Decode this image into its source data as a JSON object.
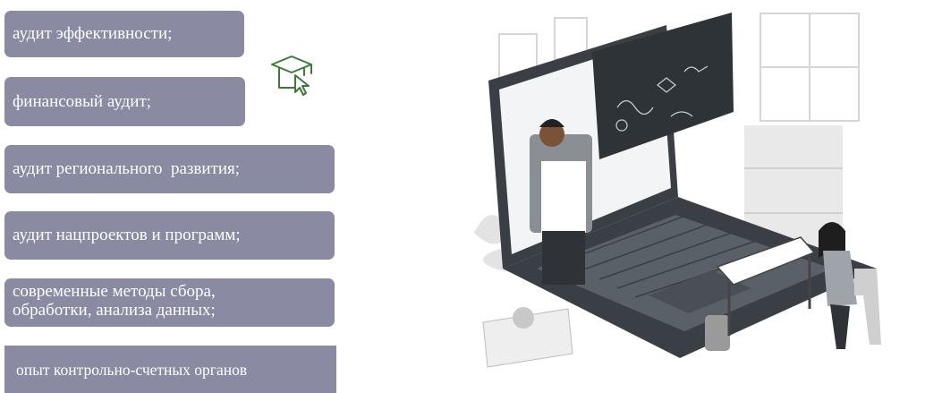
{
  "topics": [
    "аудит эффективности;",
    "финансовый аудит;",
    "аудит регионального  развития;",
    "аудит нацпроектов и программ;",
    "современные методы сбора, обработки, анализа данных;",
    "опыт контрольно-счетных органов"
  ],
  "icons": {
    "cap": "graduation-cap-cursor-icon",
    "illustration": "online-lesson-illustration"
  },
  "colors": {
    "pill_bg": "#8a8aa3",
    "pill_text": "#ffffff",
    "icon_stroke": "#3d7a36",
    "laptop_dark": "#3a3f45",
    "board_dark": "#2e3338"
  }
}
